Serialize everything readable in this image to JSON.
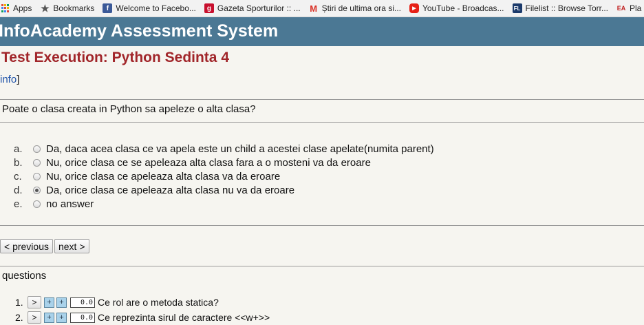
{
  "bookmarks": [
    {
      "label": "Apps",
      "icon": "apps-grid-icon",
      "color": "#e04a3a"
    },
    {
      "label": "Bookmarks",
      "icon": "star-icon",
      "color": "#555555"
    },
    {
      "label": "Welcome to Facebo...",
      "icon": "facebook-icon",
      "color": "#3b5998"
    },
    {
      "label": "Gazeta Sporturilor :: ...",
      "icon": "gazeta-icon",
      "color": "#c8102e"
    },
    {
      "label": "Știri de ultima ora si...",
      "icon": "gmail-icon",
      "color": "#d93025"
    },
    {
      "label": "YouTube - Broadcas...",
      "icon": "youtube-icon",
      "color": "#e62117"
    },
    {
      "label": "Filelist :: Browse Torr...",
      "icon": "filelist-icon",
      "color": "#1b3a6b"
    },
    {
      "label": "Pla",
      "icon": "ea-icon",
      "color": "#c02020"
    }
  ],
  "header": {
    "title": "InfoAcademy Assessment System",
    "bg": "#4b7894"
  },
  "page": {
    "title": "Test Execution: Python Sedinta 4",
    "info_link": "info",
    "info_bracket": "]"
  },
  "question": {
    "text": "Poate o clasa creata in Python sa apeleze o alta clasa?",
    "answers": [
      {
        "letter": "a.",
        "text": "Da, daca acea clasa ce va apela este un child a acestei clase apelate(numita parent)",
        "selected": false
      },
      {
        "letter": "b.",
        "text": "Nu, orice clasa ce se apeleaza alta clasa fara a o mosteni va da eroare",
        "selected": false
      },
      {
        "letter": "c.",
        "text": "Nu, orice clasa ce apeleaza alta clasa va da eroare",
        "selected": false
      },
      {
        "letter": "d.",
        "text": "Da, orice clasa ce apeleaza alta clasa nu va da eroare",
        "selected": true
      },
      {
        "letter": "e.",
        "text": "no answer",
        "selected": false
      }
    ]
  },
  "nav": {
    "previous": "< previous",
    "next": "next >"
  },
  "questions": {
    "label": "questions",
    "items": [
      {
        "num": "1.",
        "go": ">",
        "plus1": "+",
        "plus2": "+",
        "score": "0.0",
        "text": "Ce rol are o metoda statica?"
      },
      {
        "num": "2.",
        "go": ">",
        "plus1": "+",
        "plus2": "+",
        "score": "0.0",
        "text": "Ce reprezinta sirul de caractere <<w+>>"
      }
    ]
  }
}
